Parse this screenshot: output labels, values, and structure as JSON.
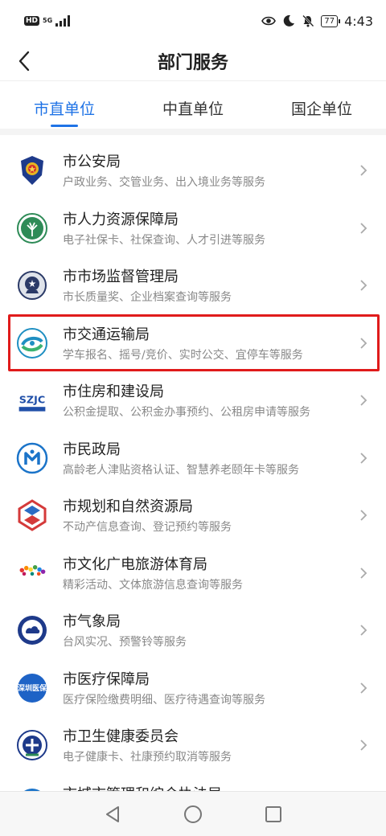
{
  "status_bar": {
    "hd_label": "HD",
    "network_top": "5G",
    "network_bottom": "",
    "battery": "77",
    "time": "4:43",
    "icons": [
      "eye-icon",
      "moon-icon",
      "mute-bell-icon"
    ]
  },
  "header": {
    "title": "部门服务",
    "back_icon": "back-arrow-icon"
  },
  "tabs": [
    {
      "label": "市直单位",
      "active": true
    },
    {
      "label": "中直单位",
      "active": false
    },
    {
      "label": "国企单位",
      "active": false
    }
  ],
  "departments": [
    {
      "name": "市公安局",
      "desc": "户政业务、交管业务、出入境业务等服务",
      "icon": "police-badge-icon",
      "color": "#1e3a8a"
    },
    {
      "name": "市人力资源保障局",
      "desc": "电子社保卡、社保查询、人才引进等服务",
      "icon": "tree-emblem-icon",
      "color": "#2e8b57"
    },
    {
      "name": "市市场监督管理局",
      "desc": "市长质量奖、企业档案查询等服务",
      "icon": "market-emblem-icon",
      "color": "#2b3a67"
    },
    {
      "name": "市交通运输局",
      "desc": "学车报名、摇号/竞价、实时公交、宜停车等服务",
      "icon": "transport-emblem-icon",
      "color": "#1f8fc2",
      "highlighted": true
    },
    {
      "name": "市住房和建设局",
      "desc": "公积金提取、公积金办事预约、公租房申请等服务",
      "icon": "szjc-logo-icon",
      "color": "#1f4fa8",
      "logo_text": "SZJC"
    },
    {
      "name": "市民政局",
      "desc": "高龄老人津贴资格认证、智慧养老颐年卡等服务",
      "icon": "civil-affairs-icon",
      "color": "#1b74c9"
    },
    {
      "name": "市规划和自然资源局",
      "desc": "不动产信息查询、登记预约等服务",
      "icon": "planning-logo-icon",
      "color": "#d43a3a"
    },
    {
      "name": "市文化广电旅游体育局",
      "desc": "精彩活动、文体旅游信息查询等服务",
      "icon": "shenzhen-culture-icon",
      "color": "#c2185b"
    },
    {
      "name": "市气象局",
      "desc": "台风实况、预警铃等服务",
      "icon": "weather-emblem-icon",
      "color": "#1e3a8a"
    },
    {
      "name": "市医疗保障局",
      "desc": "医疗保险缴费明细、医疗待遇查询等服务",
      "icon": "medical-insurance-icon",
      "color": "#1e63c6",
      "logo_text": "深圳医保"
    },
    {
      "name": "市卫生健康委员会",
      "desc": "电子健康卡、社康预约取消等服务",
      "icon": "health-emblem-icon",
      "color": "#1e3a8a"
    },
    {
      "name": "市城市管理和综合执法局",
      "desc": "",
      "icon": "city-management-icon",
      "color": "#1b74c9"
    }
  ],
  "nav_bar": {
    "buttons": [
      "back-triangle-icon",
      "home-circle-icon",
      "recents-square-icon"
    ]
  }
}
